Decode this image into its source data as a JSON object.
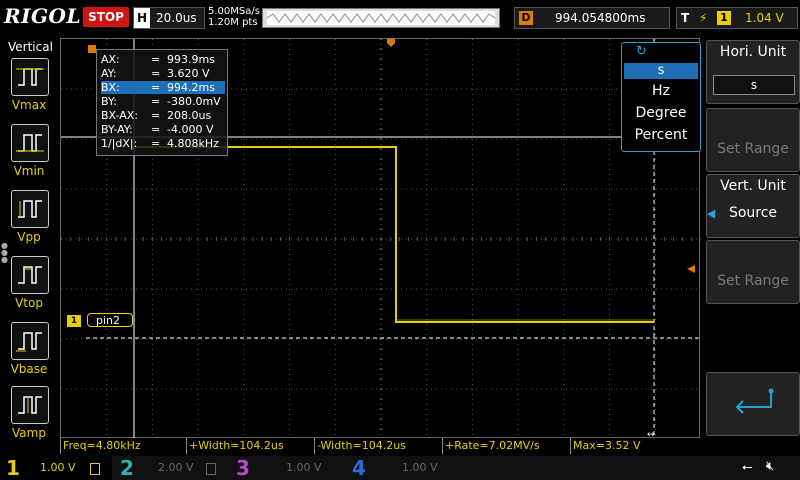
{
  "topbar": {
    "logo": "RIGOL",
    "run_state": "STOP",
    "horizontal_label": "H",
    "horizontal_scale": "20.0us",
    "sample_rate": "5.00MSa/s",
    "memory_depth": "1.20M pts",
    "delay_label": "D",
    "delay_value": "994.054800ms",
    "trigger_label": "T",
    "trigger_edge_icon": "rising-edge-icon",
    "trigger_channel": "1",
    "trigger_level": "1.04 V"
  },
  "left_menu": {
    "title": "Vertical",
    "items": [
      {
        "label": "Vmax",
        "icon": "vmax-measure-icon"
      },
      {
        "label": "Vmin",
        "icon": "vmin-measure-icon"
      },
      {
        "label": "Vpp",
        "icon": "vpp-measure-icon"
      },
      {
        "label": "Vtop",
        "icon": "vtop-measure-icon"
      },
      {
        "label": "Vbase",
        "icon": "vbase-measure-icon"
      },
      {
        "label": "Vamp",
        "icon": "vamp-measure-icon"
      }
    ]
  },
  "cursor_info": {
    "rows": [
      {
        "key": "AX:",
        "value": "993.9ms"
      },
      {
        "key": "AY:",
        "value": "3.620 V"
      },
      {
        "key": "BX:",
        "value": "994.2ms"
      },
      {
        "key": "BY:",
        "value": "-380.0mV"
      },
      {
        "key": "BX-AX:",
        "value": "208.0us"
      },
      {
        "key": "BY-AY:",
        "value": "-4.000 V"
      },
      {
        "key": "1/|dX|:",
        "value": "4.808kHz"
      }
    ],
    "selected_row": "BX:"
  },
  "unit_popup": {
    "selected": "s",
    "options": [
      "Hz",
      "Degree",
      "Percent"
    ]
  },
  "right_menu": {
    "hori_unit_title": "Hori. Unit",
    "hori_unit_value": "s",
    "set_range_1": "Set Range",
    "vert_unit_title": "Vert. Unit",
    "vert_unit_value": "Source",
    "set_range_2": "Set Range",
    "back_icon": "return-arrow-icon"
  },
  "channel_label": "pin2",
  "channel_marker": "1",
  "measurements": [
    "Freq=4.80kHz",
    "+Width=104.2us",
    "-Width=104.2us",
    "+Rate=7.02MV/s",
    "Max=3.52 V"
  ],
  "channels": [
    {
      "num": "1",
      "scale": "1.00 V",
      "color": "#e8d000"
    },
    {
      "num": "2",
      "scale": "2.00 V",
      "color": "#2bb3b3"
    },
    {
      "num": "3",
      "scale": "1.00 V",
      "color": "#b04ac8"
    },
    {
      "num": "4",
      "scale": "1.00 V",
      "color": "#2a6fd6"
    }
  ],
  "status_icons": [
    "usb-icon",
    "speaker-muted-icon"
  ],
  "colors": {
    "ch1": "#e8d000",
    "accent": "#1e6fb8",
    "stop": "#d01414",
    "marker": "#e07b00"
  }
}
